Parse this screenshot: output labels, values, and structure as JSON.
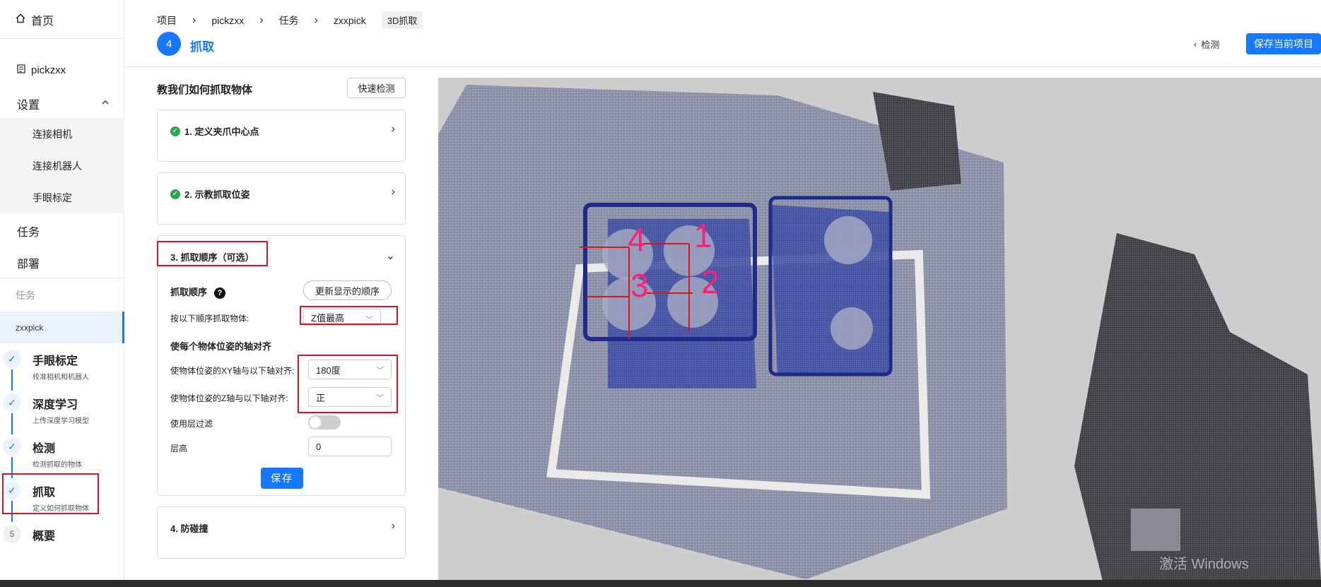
{
  "sidebar": {
    "home": "首页",
    "project": "pickzxx",
    "settings": "设置",
    "settings_items": [
      "连接相机",
      "连接机器人",
      "手眼标定"
    ],
    "task": "任务",
    "deploy": "部署",
    "task_section": "任务",
    "active_task": "zxxpick",
    "steps": [
      {
        "title": "手眼标定",
        "sub": "校准相机和机器人",
        "marker": "✓"
      },
      {
        "title": "深度学习",
        "sub": "上传深度学习模型",
        "marker": "✓"
      },
      {
        "title": "检测",
        "sub": "检测抓取的物体",
        "marker": "✓"
      },
      {
        "title": "抓取",
        "sub": "定义如何抓取物体",
        "marker": "✓"
      },
      {
        "title": "概要",
        "sub": "",
        "marker": "5"
      }
    ]
  },
  "header": {
    "breadcrumbs": [
      "项目",
      "pickzxx",
      "任务",
      "zxxpick",
      "3D抓取"
    ],
    "step_number": "4",
    "title": "抓取",
    "back_label": "检测",
    "save_project": "保存当前项目"
  },
  "panel": {
    "heading": "教我们如何抓取物体",
    "quick_detect": "快速检测",
    "card1": "1. 定义夹爪中心点",
    "card2": "2. 示教抓取位姿",
    "card3": "3. 抓取顺序（可选）",
    "grab_order_label": "抓取顺序",
    "help": "?",
    "update_order": "更新显示的顺序",
    "order_by_label": "按以下顺序抓取物体:",
    "order_by_value": "Z值最高",
    "align_heading": "使每个物体位姿的轴对齐",
    "xy_label": "使物体位姿的XY轴与以下轴对齐:",
    "xy_value": "180度",
    "z_label": "使物体位姿的Z轴与以下轴对齐:",
    "z_value": "正",
    "layer_filter_label": "使用层过滤",
    "layer_filter_on": false,
    "layer_height_label": "层高",
    "layer_height_value": "0",
    "save": "保存",
    "card4": "4. 防碰撞"
  },
  "view": {
    "order_labels": [
      "4",
      "1",
      "3",
      "2"
    ],
    "watermark": "激活 Windows"
  },
  "colors": {
    "accent": "#1677ff",
    "highlight": "#e0141e",
    "order_label": "#ff1e78"
  }
}
